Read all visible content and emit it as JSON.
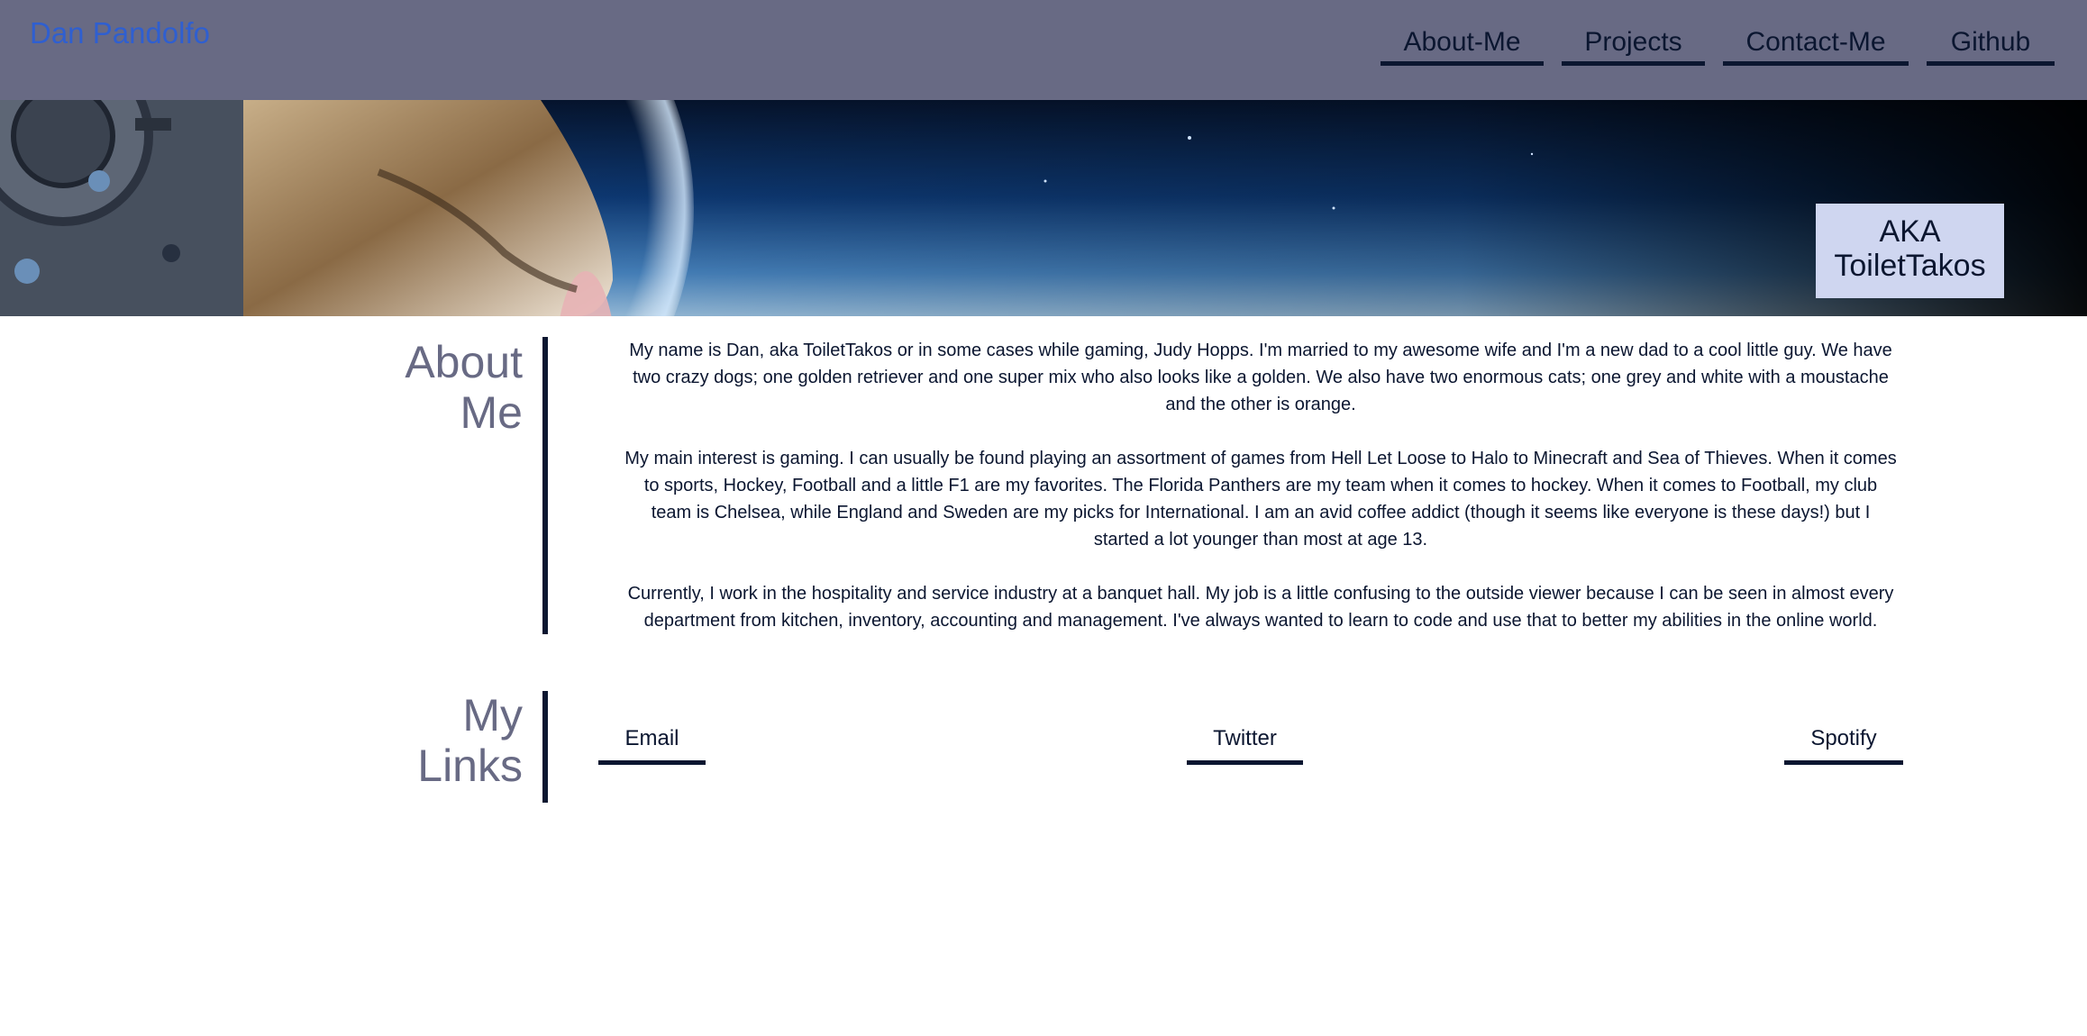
{
  "header": {
    "brand": "Dan Pandolfo",
    "nav": [
      "About-Me",
      "Projects",
      "Contact-Me",
      "Github"
    ]
  },
  "hero": {
    "aka_line1": "AKA",
    "aka_line2": "ToiletTakos"
  },
  "about": {
    "heading_line1": "About",
    "heading_line2": "Me",
    "paragraphs": [
      "My name is Dan, aka ToiletTakos or in some cases while gaming, Judy Hopps. I'm married to my awesome wife and I'm a new dad to a cool little guy. We have two crazy dogs; one golden retriever and one super mix who also looks like a golden. We also have two enormous cats; one grey and white with a moustache and the other is orange.",
      "My main interest is gaming. I can usually be found playing an assortment of games from Hell Let Loose to Halo to Minecraft and Sea of Thieves. When it comes to sports, Hockey, Football and a little F1 are my favorites. The Florida Panthers are my team when it comes to hockey. When it comes to Football, my club team is Chelsea, while England and Sweden are my picks for International. I am an avid coffee addict (though it seems like everyone is these days!) but I started a lot younger than most at age 13.",
      "Currently, I work in the hospitality and service industry at a banquet hall. My job is a little confusing to the outside viewer because I can be seen in almost every department from kitchen, inventory, accounting and management. I've always wanted to learn to code and use that to better my abilities in the online world."
    ]
  },
  "links": {
    "heading_line1": "My",
    "heading_line2": "Links",
    "items": [
      "Email",
      "Twitter",
      "Spotify"
    ]
  },
  "colors": {
    "header_bg": "#686a84",
    "brand": "#2f5fd0",
    "dark_navy": "#0b1630",
    "aka_bg": "#cfd6f0"
  }
}
